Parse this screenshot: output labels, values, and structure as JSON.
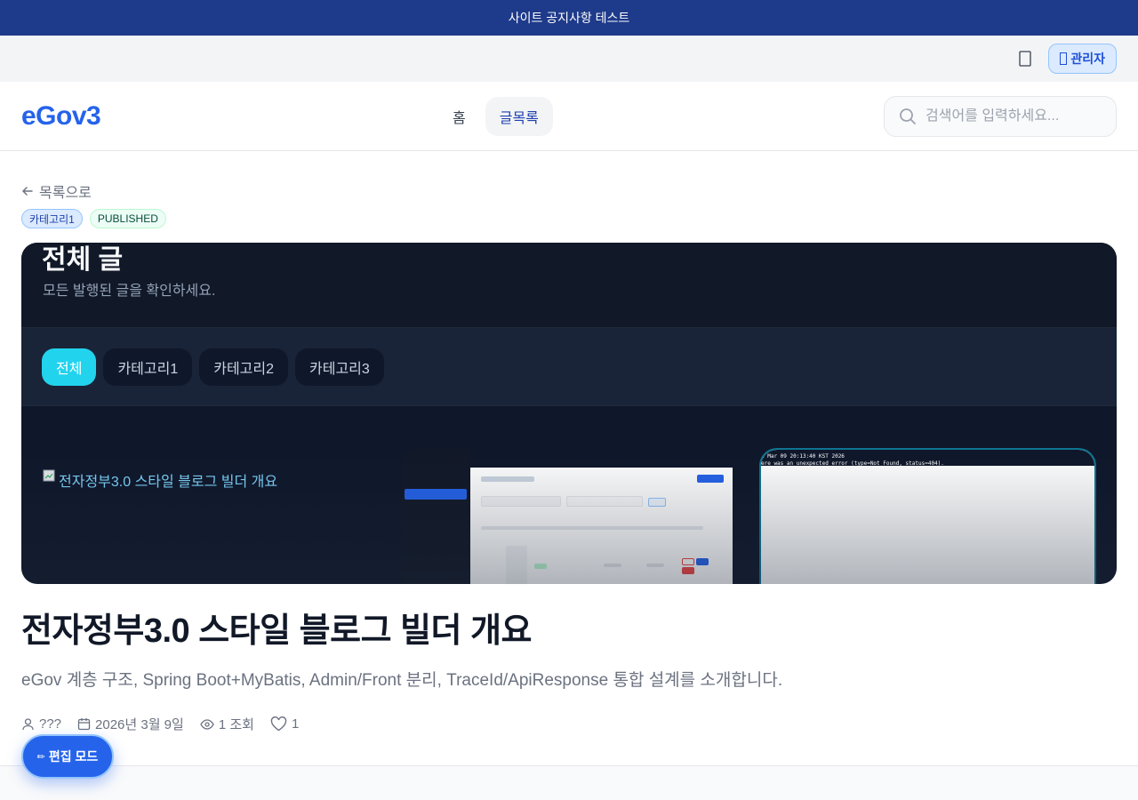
{
  "notice": {
    "text": "사이트 공지사항 테스트"
  },
  "utilbar": {
    "admin_label": "관리자",
    "admin_icon": "user-icon",
    "bell_icon": "bell-icon"
  },
  "header": {
    "logo": "eGov3",
    "nav": [
      {
        "label": "홈"
      },
      {
        "label": "글목록",
        "active": true
      }
    ],
    "search_placeholder": "검색어를 입력하세요..."
  },
  "post": {
    "back_label": "목록으로",
    "tags": [
      "카테고리1",
      "PUBLISHED"
    ],
    "hero": {
      "title": "전체 글",
      "subtitle": "모든 발행된 글을 확인하세요.",
      "tabs": [
        "전체",
        "카테고리1",
        "카테고리2",
        "카테고리3"
      ],
      "card1_alt": "전자정부3.0 스타일 블로그 빌더 개요",
      "terminal_lines": [
        "a Mar 09 20:13:40 KST 2026",
        "ere was an unexpected error (type=Not Found, status=404)."
      ]
    },
    "title": "전자정부3.0 스타일 블로그 빌더 개요",
    "excerpt": "eGov 계층 구조, Spring Boot+MyBatis, Admin/Front 분리, TraceId/ApiResponse 통합 설계를 소개합니다.",
    "meta": {
      "author": "???",
      "date": "2026년 3월 9일",
      "views": "1 조회",
      "likes": "1"
    }
  },
  "edit_button": {
    "label": "편집 모드"
  },
  "colors": {
    "primary": "#2563eb",
    "notice_bg": "#1e3a8a",
    "accent_cyan": "#22d3ee"
  }
}
